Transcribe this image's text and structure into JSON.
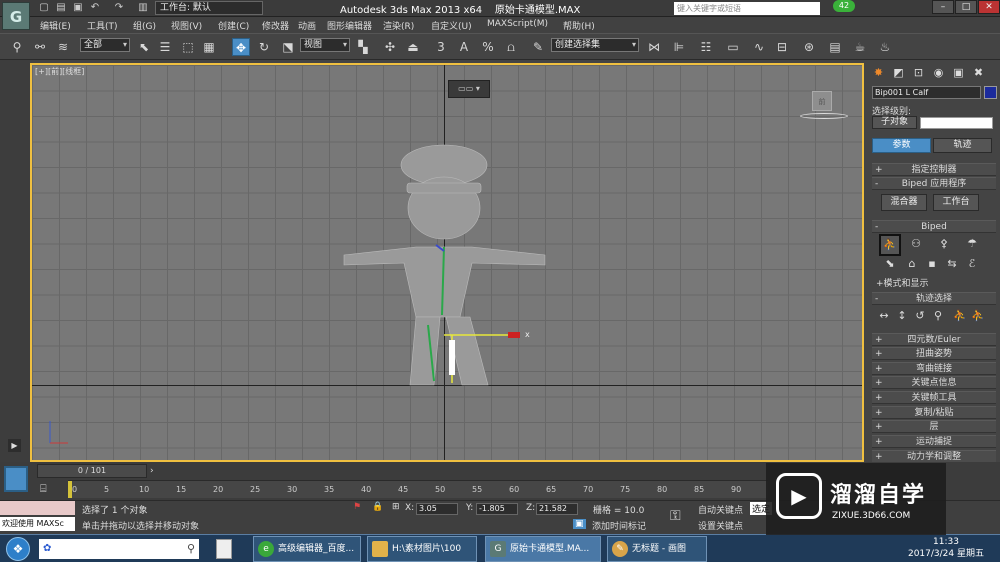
{
  "title_bar": {
    "workspace_label": "工作台: 默认",
    "app_title": "Autodesk 3ds Max  2013 x64",
    "file_name": "原始卡通模型.MAX",
    "search_placeholder": "键入关键字或短语",
    "badge": "42",
    "min": "–",
    "max": "□",
    "close": "✕"
  },
  "menu": [
    "编辑(E)",
    "工具(T)",
    "组(G)",
    "视图(V)",
    "创建(C)",
    "修改器",
    "动画",
    "图形编辑器",
    "渲染(R)",
    "自定义(U)",
    "MAXScript(M)",
    "帮助(H)"
  ],
  "toolbar": {
    "filter": "全部",
    "ref_coord": "视图",
    "snap_label": "3",
    "angle_label": "A",
    "percent_label": "%",
    "selection_set": "创建选择集"
  },
  "viewport": {
    "label": "[+][前][线框]",
    "x_axis": "x",
    "cube_label": "前",
    "vp_menu": "▭▭ ▾"
  },
  "command_panel": {
    "object_name": "Bip001 L Calf",
    "selection_level_label": "选择级别:",
    "sub_object": "子对象",
    "tab_params": "参数",
    "tab_track": "轨迹",
    "rollouts_top": [
      {
        "sign": "+",
        "label": "指定控制器"
      },
      {
        "sign": "-",
        "label": "Biped 应用程序"
      }
    ],
    "btn_mixer": "混合器",
    "btn_workbench": "工作台",
    "biped_rollout": {
      "sign": "-",
      "label": "Biped"
    },
    "mode_display": "+模式和显示",
    "track_select": {
      "sign": "-",
      "label": "轨迹选择"
    },
    "rollouts_bottom": [
      {
        "sign": "+",
        "label": "四元数/Euler"
      },
      {
        "sign": "+",
        "label": "扭曲姿势"
      },
      {
        "sign": "+",
        "label": "弯曲链接"
      },
      {
        "sign": "+",
        "label": "关键点信息"
      },
      {
        "sign": "+",
        "label": "关键帧工具"
      },
      {
        "sign": "+",
        "label": "复制/粘贴"
      },
      {
        "sign": "+",
        "label": "层"
      },
      {
        "sign": "+",
        "label": "运动捕捉"
      },
      {
        "sign": "+",
        "label": "动力学和调整"
      }
    ]
  },
  "timeline": {
    "slider": "0 / 101",
    "ticks": [
      "0",
      "5",
      "10",
      "15",
      "20",
      "25",
      "30",
      "35",
      "40",
      "45",
      "50",
      "55",
      "60",
      "65",
      "70",
      "75",
      "80",
      "85",
      "90"
    ]
  },
  "status": {
    "maxscript": "欢迎使用 MAXSc",
    "selected": "选择了 1 个对象",
    "hint": "单击并拖动以选择并移动对象",
    "x_label": "X:",
    "x": "3.05",
    "y_label": "Y:",
    "y": "-1.805",
    "z_label": "Z:",
    "z": "21.582",
    "grid": "栅格 = 10.0",
    "auto_key": "自动关键点",
    "set_key": "设置关键点",
    "add_time_tag": "添加时间标记",
    "selected_short": "选定"
  },
  "taskbar": {
    "tasks": [
      "高级编辑器_百度...",
      "H:\\素材图片\\100",
      "原始卡通模型.MA...",
      "无标题 - 画图"
    ],
    "time": "11:33",
    "date": "2017/3/24 星期五"
  },
  "watermark": {
    "title": "溜溜自学",
    "url": "ZIXUE.3D66.COM"
  }
}
